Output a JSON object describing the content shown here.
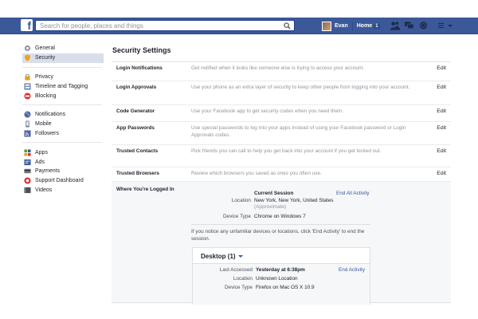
{
  "topbar": {
    "logo_letter": "f",
    "search_placeholder": "Search for people, places and things",
    "user_name": "Evan",
    "home_label": "Home",
    "home_count": "1",
    "icons": [
      "friend-requests-icon",
      "messages-icon",
      "notifications-icon",
      "settings-menu-icon"
    ]
  },
  "leftnav": {
    "groups": [
      [
        {
          "label": "General",
          "icon": "gear-icon",
          "color": "#9197a3"
        },
        {
          "label": "Security",
          "icon": "shield-icon",
          "color": "#f2a122",
          "active": true
        }
      ],
      [
        {
          "label": "Privacy",
          "icon": "lock-icon",
          "color": "#e0a417"
        },
        {
          "label": "Timeline and Tagging",
          "icon": "timeline-icon",
          "color": "#6d84b4"
        },
        {
          "label": "Blocking",
          "icon": "block-icon",
          "color": "#d73333"
        }
      ],
      [
        {
          "label": "Notifications",
          "icon": "globe-icon",
          "color": "#4e69a2"
        },
        {
          "label": "Mobile",
          "icon": "phone-icon",
          "color": "#6f7580"
        },
        {
          "label": "Followers",
          "icon": "rss-icon",
          "color": "#4e69a2"
        }
      ],
      [
        {
          "label": "Apps",
          "icon": "apps-icon",
          "color": "#5aa12c"
        },
        {
          "label": "Ads",
          "icon": "ads-icon",
          "color": "#3b5998"
        },
        {
          "label": "Payments",
          "icon": "payments-icon",
          "color": "#6f7580"
        },
        {
          "label": "Support Dashboard",
          "icon": "lifebuoy-icon",
          "color": "#d73333"
        },
        {
          "label": "Videos",
          "icon": "video-icon",
          "color": "#4b4f56"
        }
      ]
    ]
  },
  "main": {
    "title": "Security Settings",
    "edit_label": "Edit",
    "rows": [
      {
        "label": "Login Notifications",
        "desc": "Get notified when it looks like someone else is trying to access your account."
      },
      {
        "label": "Login Approvals",
        "desc": "Use your phone as an extra layer of security to keep other people from logging into your account."
      },
      {
        "label": "Code Generator",
        "desc": "Use your Facebook app to get security codes when you need them."
      },
      {
        "label": "App Passwords",
        "desc": "Use special passwords to log into your apps instead of using your Facebook password or Login Approvals codes."
      },
      {
        "label": "Trusted Contacts",
        "desc": "Pick friends you can call to help you get back into your account if you get locked out."
      },
      {
        "label": "Trusted Browsers",
        "desc": "Review which browsers you saved as ones you often use."
      }
    ],
    "logged_in": {
      "label": "Where You're Logged In",
      "current_session_label": "Current Session",
      "end_all_label": "End All Activity",
      "location_key": "Location",
      "location_val": "New York, New York, United States",
      "approx": "(Approximate)",
      "device_key": "Device Type",
      "device_val": "Chrome on Windows 7",
      "notice": "If you notice any unfamiliar devices or locations, click 'End Activity' to end the session.",
      "desktop_label": "Desktop (1)",
      "last_accessed_key": "Last Accessed",
      "last_accessed_val": "Yesterday at 6:38pm",
      "end_activity_label": "End Activity",
      "loc2_key": "Location",
      "loc2_val": "Unknown Location",
      "dev2_key": "Device Type",
      "dev2_val": "Firefox on Mac OS X 10.9"
    }
  }
}
